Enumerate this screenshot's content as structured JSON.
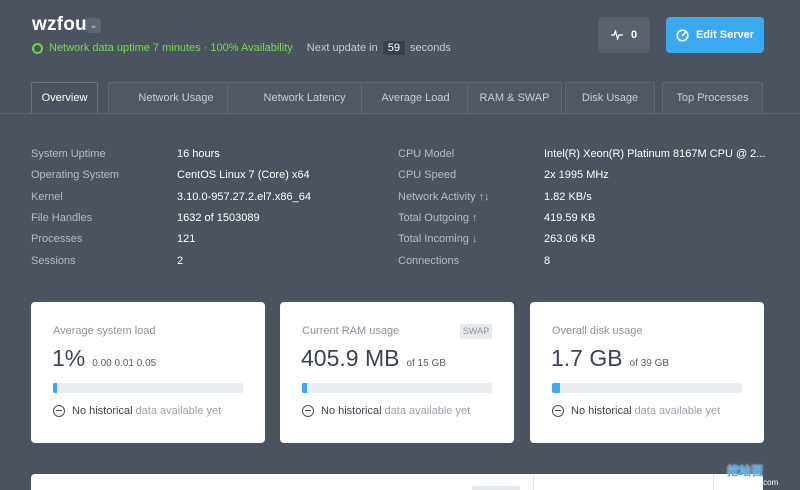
{
  "header": {
    "server_name": "wzfou",
    "dropdown_glyph": "⌄",
    "status_text": "Network data uptime 7 minutes · 100% Availability",
    "update_label": "Next update in",
    "update_count": "59",
    "update_suffix": "seconds",
    "pulse_count": "0",
    "edit_label": "Edit Server",
    "colors": {
      "status": "#79d653",
      "accent": "#3aa9ef"
    }
  },
  "tabs": [
    {
      "label": "Overview",
      "active": true
    },
    {
      "label": "Network Usage"
    },
    {
      "label": "Network Latency"
    },
    {
      "label": "Average Load"
    },
    {
      "label": "RAM & SWAP"
    },
    {
      "label": "Disk Usage"
    },
    {
      "label": "Top Processes"
    }
  ],
  "info_left": [
    {
      "label": "System Uptime",
      "value": "16 hours"
    },
    {
      "label": "Operating System",
      "value": "CentOS Linux 7 (Core) x64"
    },
    {
      "label": "Kernel",
      "value": "3.10.0-957.27.2.el7.x86_64"
    },
    {
      "label": "File Handles",
      "value": "1632 of 1503089"
    },
    {
      "label": "Processes",
      "value": "121"
    },
    {
      "label": "Sessions",
      "value": "2"
    }
  ],
  "info_right": [
    {
      "label": "CPU Model",
      "value": "Intel(R) Xeon(R) Platinum 8167M CPU @ 2..."
    },
    {
      "label": "CPU Speed",
      "value": "2x 1995 MHz"
    },
    {
      "label": "Network Activity ↑↓",
      "value": "1.82 KB/s"
    },
    {
      "label": "Total Outgoing ↑",
      "value": "419.59 KB"
    },
    {
      "label": "Total Incoming ↓",
      "value": "263.06 KB"
    },
    {
      "label": "Connections",
      "value": "8"
    }
  ],
  "cards": [
    {
      "title": "Average system load",
      "value": "1%",
      "sub": "0.00 0.01 0.05",
      "fill": 0.01,
      "foot_strong": "No historical",
      "foot_light": "data available yet"
    },
    {
      "title": "Current RAM usage",
      "badge": "SWAP",
      "value": "405.9 MB",
      "sub": "of 15 GB",
      "fill": 0.027,
      "foot_strong": "No historical",
      "foot_light": "data available yet"
    },
    {
      "title": "Overall disk usage",
      "value": "1.7 GB",
      "sub": "of 39 GB",
      "fill": 0.044,
      "foot_strong": "No historical",
      "foot_light": "data available yet"
    }
  ],
  "watermark": {
    "main": "挖站否",
    "sub": "wzfou.com"
  },
  "icons": {
    "status": "status-ring-icon",
    "pulse": "pulse-icon",
    "edit": "gauge-icon",
    "nohist": "minus-circle-icon"
  }
}
